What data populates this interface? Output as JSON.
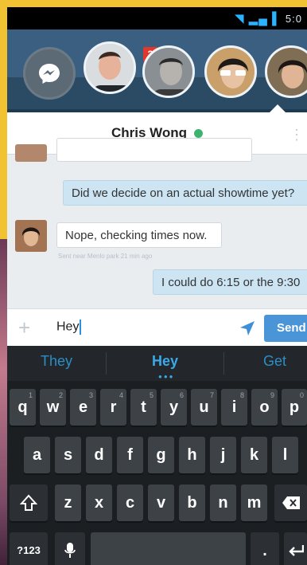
{
  "status_bar": {
    "time": "5:0"
  },
  "chat_heads": {
    "unread_badge": "2"
  },
  "conversation": {
    "contact_name": "Chris Wong",
    "messages": [
      {
        "direction": "out",
        "text": "Did we decide on an actual showtime yet?"
      },
      {
        "direction": "in",
        "text": "Nope, checking times now.",
        "meta": "Sent near Menlo park 21 min ago"
      },
      {
        "direction": "out",
        "text": "I could do 6:15 or the 9:30"
      }
    ]
  },
  "composer": {
    "text": "Hey",
    "send_label": "Send"
  },
  "keyboard": {
    "suggestions": [
      "They",
      "Hey",
      "Get"
    ],
    "row1": [
      {
        "k": "q",
        "n": "1"
      },
      {
        "k": "w",
        "n": "2"
      },
      {
        "k": "e",
        "n": "3"
      },
      {
        "k": "r",
        "n": "4"
      },
      {
        "k": "t",
        "n": "5"
      },
      {
        "k": "y",
        "n": "6"
      },
      {
        "k": "u",
        "n": "7"
      },
      {
        "k": "i",
        "n": "8"
      },
      {
        "k": "o",
        "n": "9"
      },
      {
        "k": "p",
        "n": "0"
      }
    ],
    "row2": [
      "a",
      "s",
      "d",
      "f",
      "g",
      "h",
      "j",
      "k",
      "l"
    ],
    "row3": [
      "z",
      "x",
      "c",
      "v",
      "b",
      "n",
      "m"
    ],
    "symbols_label": "?123",
    "period_label": "."
  }
}
